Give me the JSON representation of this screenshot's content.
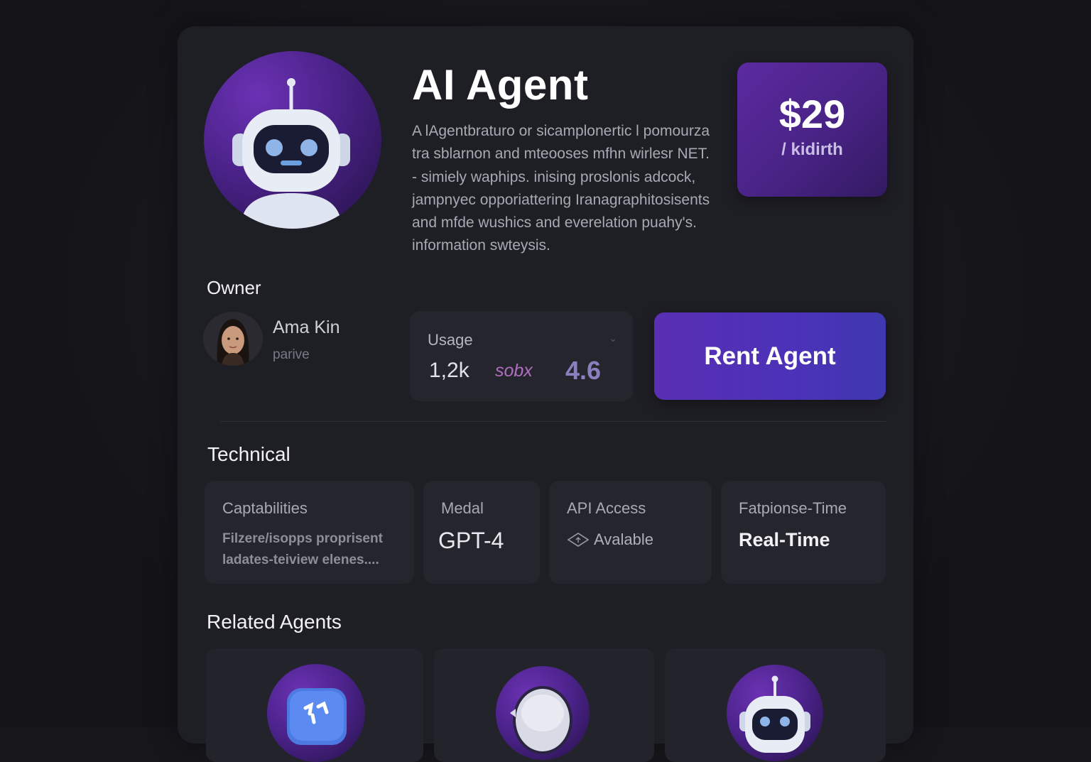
{
  "agent": {
    "title": "AI Agent",
    "description": "A lAgentbraturo or sicamplonertic l pomourza tra sblarnon and mteooses mfhn wirlesr NET. - simiely waphips. inising proslonis adcock, jampnyec opporiattering Iranagraphitosisents and mfde wushics and everelation puahy's. information swteysis.",
    "avatar_icon": "robot-icon"
  },
  "price": {
    "value": "$29",
    "period": "/ kidirth"
  },
  "owner": {
    "label": "Owner",
    "name": "Ama Kin",
    "subtitle": "parive"
  },
  "usage": {
    "label": "Usage",
    "count": "1,2k",
    "squiggle": "sobx",
    "rating": "4.6"
  },
  "rent_button": {
    "label": "Rent Agent"
  },
  "technical": {
    "title": "Technical",
    "cards": [
      {
        "label": "Captabilities",
        "value": "Filzere/isopps proprisent ladates-teiview elenes...."
      },
      {
        "label": "Medal",
        "value": "GPT-4"
      },
      {
        "label": "API Access",
        "value": "Avalable"
      },
      {
        "label": "Fatpionse-Time",
        "value": "Real-Time"
      }
    ]
  },
  "related": {
    "title": "Related Agents",
    "items": [
      {
        "icon": "chat-bot-icon"
      },
      {
        "icon": "astronaut-icon"
      },
      {
        "icon": "robot-icon"
      }
    ]
  },
  "colors": {
    "background": "#16161b",
    "card": "#1e1e25",
    "accent_purple": "#5a2fb4",
    "accent_indigo": "#3f38b0"
  }
}
